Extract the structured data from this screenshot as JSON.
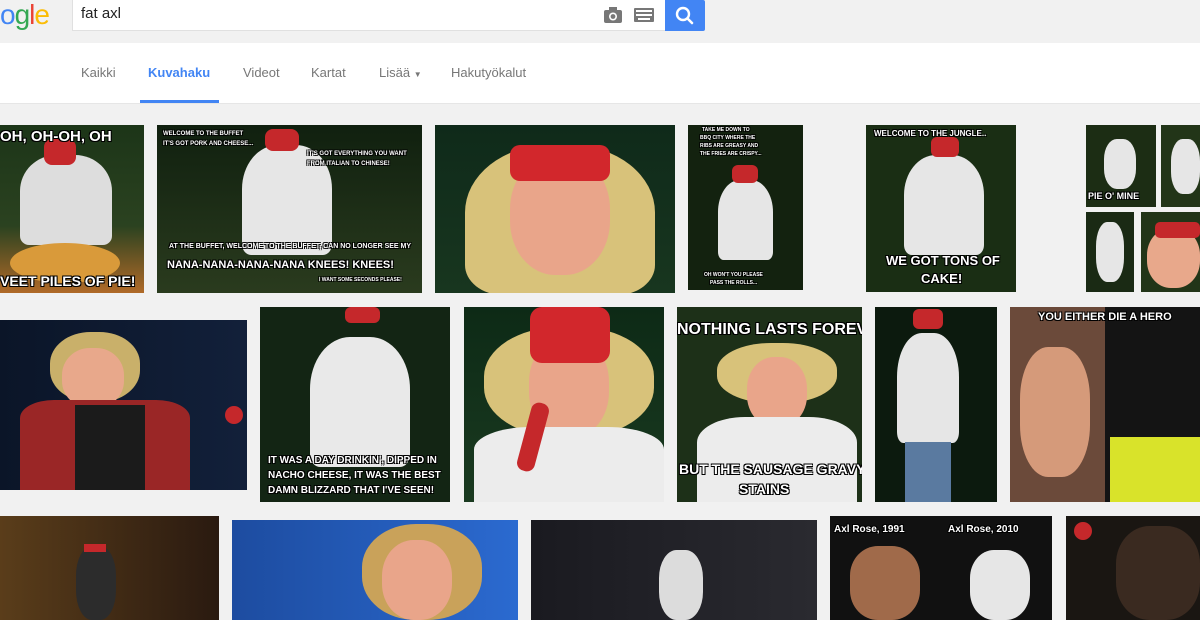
{
  "search": {
    "query": "fat axl",
    "logo_text": "ogle"
  },
  "colors": {
    "accent": "#4285f4",
    "background": "#f1f1f1"
  },
  "icons": [
    "camera-icon",
    "keyboard-icon",
    "search-icon",
    "caret-down-icon"
  ],
  "tabs": [
    {
      "label": "Kaikki"
    },
    {
      "label": "Kuvahaku",
      "active": true
    },
    {
      "label": "Videot"
    },
    {
      "label": "Kartat"
    },
    {
      "label": "Lisää"
    },
    {
      "label": "Hakutyökalut"
    }
  ],
  "images": [
    {
      "captions": [
        "OH, OH-OH, OH",
        "VEET PILES OF PIE!"
      ]
    },
    {
      "captions": [
        "WELCOME TO THE BUFFET",
        "IT'S GOT PORK AND CHEESE...",
        "IT'S GOT EVERYTHING YOU WANT",
        "FROM ITALIAN TO CHINESE!",
        "AT THE BUFFET, WELCOME TO THE BUFFET, CAN NO LONGER SEE MY",
        "NANA-NANA-NANA-NANA KNEES! KNEES!",
        "I WANT SOME SECONDS PLEASE!"
      ]
    },
    {
      "captions": []
    },
    {
      "captions": [
        "TAKE ME DOWN TO",
        "BBQ CITY WHERE THE",
        "RIBS ARE GREASY AND",
        "THE FRIES ARE CRISPY...",
        "OH WON'T YOU PLEASE",
        "PASS THE ROLLS..."
      ]
    },
    {
      "captions": [
        "WELCOME TO THE JUNGLE..",
        "WE GOT TONS OF",
        "CAKE!"
      ]
    },
    {
      "captions": [
        "PIE O' MINE"
      ]
    },
    {
      "captions": []
    },
    {
      "captions": []
    },
    {
      "captions": []
    },
    {
      "captions": []
    },
    {
      "captions": [
        "IT WAS A DAY DRINKIN', DIPPED IN",
        "NACHO CHEESE, IT WAS THE BEST",
        "DAMN BLIZZARD THAT I'VE SEEN!"
      ]
    },
    {
      "captions": []
    },
    {
      "captions": [
        "NOTHING LASTS FOREVER",
        "BUT THE SAUSAGE GRAVY",
        "STAINS"
      ]
    },
    {
      "captions": []
    },
    {
      "captions": [
        "YOU EITHER DIE A HERO"
      ]
    },
    {
      "captions": []
    },
    {
      "captions": []
    },
    {
      "captions": []
    },
    {
      "captions": [
        "Axl Rose, 1991",
        "Axl Rose, 2010"
      ]
    },
    {
      "captions": []
    }
  ]
}
